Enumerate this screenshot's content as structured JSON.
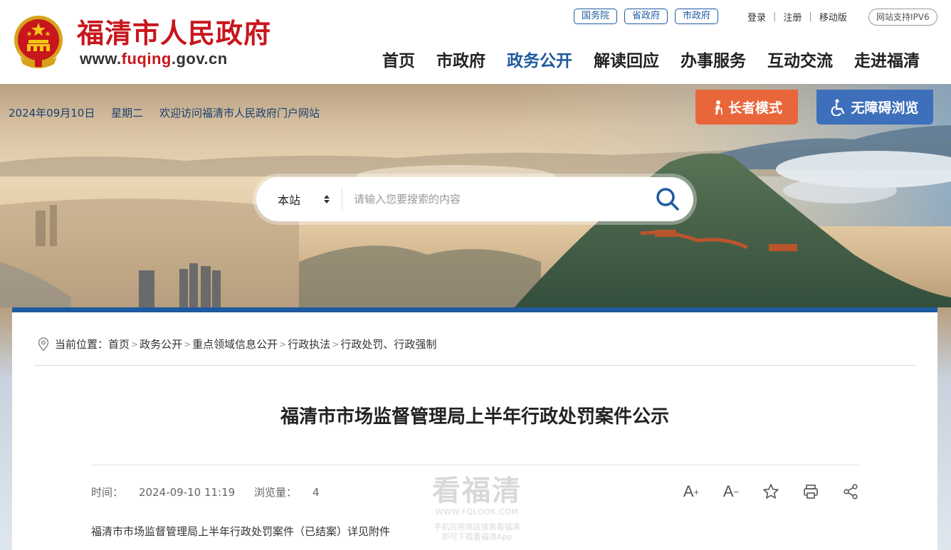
{
  "header": {
    "site_name": "福清市人民政府",
    "site_url_prefix": "www.",
    "site_url_highlight": "fuqing",
    "site_url_suffix": ".gov.cn",
    "gov_links": [
      "国务院",
      "省政府",
      "市政府"
    ],
    "util_links": [
      "登录",
      "注册",
      "移动版"
    ],
    "ipv6_badge": "网站支持IPV6",
    "nav": [
      "首页",
      "市政府",
      "政务公开",
      "解读回应",
      "办事服务",
      "互动交流",
      "走进福清"
    ],
    "active_nav": "政务公开",
    "brand_color": "#c8161d",
    "accent_color": "#1e5aa0"
  },
  "banner": {
    "date": "2024年09月10日",
    "weekday": "星期二",
    "welcome": "欢迎访问福清市人民政府门户网站",
    "elder_mode_label": "长者模式",
    "elder_mode_icon": "elder-icon",
    "accessible_label": "无障碍浏览",
    "accessible_icon": "wheelchair-icon",
    "elder_color": "#e8663a",
    "accessible_color": "#3d6fba"
  },
  "search": {
    "scope": "本站",
    "placeholder": "请输入您要搜索的内容"
  },
  "breadcrumb": {
    "label": "当前位置：",
    "items": [
      "首页",
      "政务公开",
      "重点领域信息公开",
      "行政执法",
      "行政处罚、行政强制"
    ]
  },
  "article": {
    "title": "福清市市场监督管理局上半年行政处罚案件公示",
    "time_label": "时间：",
    "time": "2024-09-10 11:19",
    "views_label": "浏览量：",
    "views": "4",
    "body": "福清市市场监督管理局上半年行政处罚案件（已结案）详见附件"
  },
  "tools": [
    "font-increase-icon",
    "font-decrease-icon",
    "star-icon",
    "print-icon",
    "share-icon"
  ],
  "watermark": {
    "title": "看福清",
    "url": "WWW.FQLOOK.COM",
    "line1": "手机应用商店搜索看福清",
    "line2": "即可下载看福清App"
  }
}
